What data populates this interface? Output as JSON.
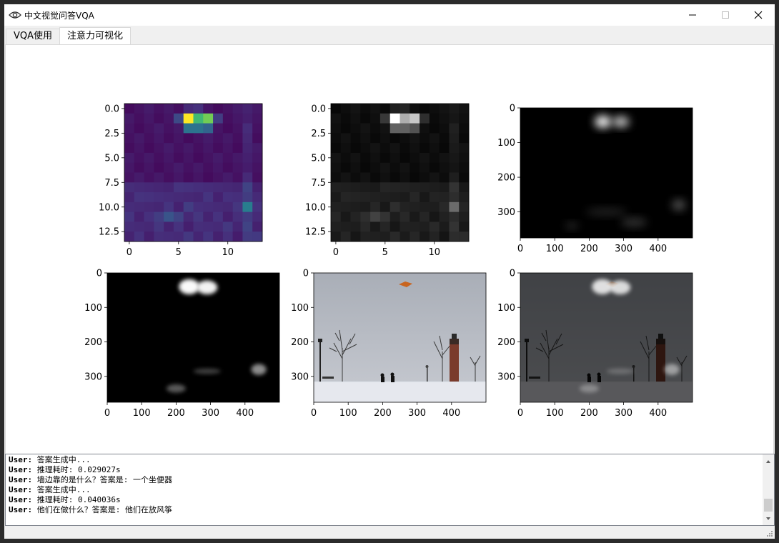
{
  "window": {
    "title": "中文视觉问答VQA"
  },
  "tabs": [
    {
      "label": "VQA使用",
      "active": false
    },
    {
      "label": "注意力可视化",
      "active": true
    }
  ],
  "plots": {
    "small_y_ticks": [
      "0.0",
      "2.5",
      "5.0",
      "7.5",
      "10.0",
      "12.5"
    ],
    "small_x_ticks": [
      "0",
      "5",
      "10"
    ],
    "large_y_ticks": [
      "0",
      "100",
      "200",
      "300"
    ],
    "large_x_ticks": [
      "0",
      "100",
      "200",
      "300",
      "400"
    ],
    "colors": {
      "viridis_low": "#440154",
      "viridis_high": "#fde725",
      "gray_low": "#000000",
      "gray_high": "#ffffff"
    }
  },
  "log": {
    "lines": [
      {
        "user": "User:",
        "text": "答案生成中..."
      },
      {
        "user": "User:",
        "text": "推理耗时: 0.029027s"
      },
      {
        "user": "User:",
        "text": "墙边靠的是什么？答案是: 一个坐便器"
      },
      {
        "user": "User:",
        "text": "答案生成中..."
      },
      {
        "user": "User:",
        "text": "推理耗时: 0.040036s"
      },
      {
        "user": "User:",
        "text": "他们在做什么？答案是: 他们在放风筝"
      }
    ]
  }
}
